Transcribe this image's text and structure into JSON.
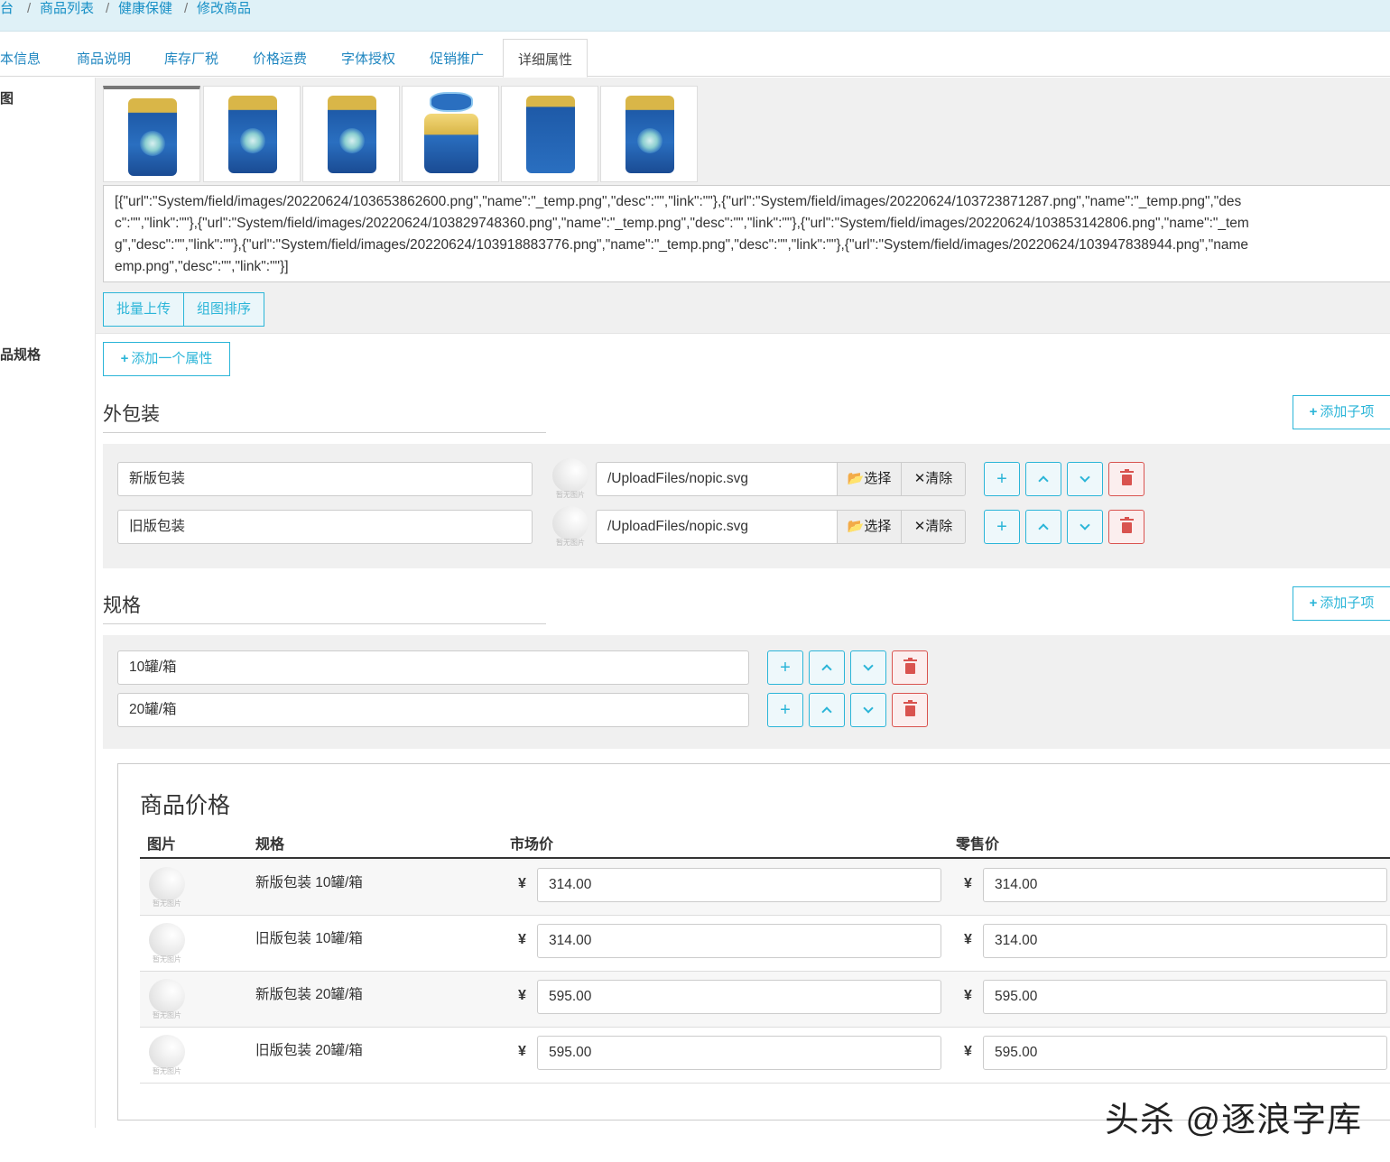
{
  "breadcrumb": [
    "台",
    "商品列表",
    "健康保健",
    "修改商品"
  ],
  "breadcrumb_sep": "/",
  "tabs": [
    "本信息",
    "商品说明",
    "库存厂税",
    "价格运费",
    "字体授权",
    "促销推广",
    "详细属性"
  ],
  "active_tab": "详细属性",
  "labels": {
    "images": "图",
    "specs": "品规格"
  },
  "gallery_json": [
    "[{\"url\":\"System/field/images/20220624/103653862600.png\",\"name\":\"_temp.png\",\"desc\":\"\",\"link\":\"\"},{\"url\":\"System/field/images/20220624/103723871287.png\",\"name\":\"_temp.png\",\"des",
    "c\":\"\",\"link\":\"\"},{\"url\":\"System/field/images/20220624/103829748360.png\",\"name\":\"_temp.png\",\"desc\":\"\",\"link\":\"\"},{\"url\":\"System/field/images/20220624/103853142806.png\",\"name\":\"_tem",
    "g\",\"desc\":\"\",\"link\":\"\"},{\"url\":\"System/field/images/20220624/103918883776.png\",\"name\":\"_temp.png\",\"desc\":\"\",\"link\":\"\"},{\"url\":\"System/field/images/20220624/103947838944.png\",\"name",
    "emp.png\",\"desc\":\"\",\"link\":\"\"}]"
  ],
  "buttons": {
    "batch_upload": "批量上传",
    "sort_images": "组图排序",
    "add_attribute": "添加一个属性",
    "add_child": "添加子项",
    "select": "选择",
    "clear": "清除"
  },
  "groups": {
    "packaging": {
      "title": "外包装",
      "items": [
        {
          "value": "新版包装",
          "image_path": "/UploadFiles/nopic.svg"
        },
        {
          "value": "旧版包装",
          "image_path": "/UploadFiles/nopic.svg"
        }
      ]
    },
    "spec": {
      "title": "规格",
      "items": [
        {
          "value": "10罐/箱"
        },
        {
          "value": "20罐/箱"
        }
      ]
    }
  },
  "nopic_caption": "暂无图片",
  "price": {
    "title": "商品价格",
    "headers": {
      "image": "图片",
      "spec": "规格",
      "market": "市场价",
      "retail": "零售价"
    },
    "currency": "¥",
    "rows": [
      {
        "spec": "新版包装 10罐/箱",
        "market": "314.00",
        "retail": "314.00"
      },
      {
        "spec": "旧版包装 10罐/箱",
        "market": "314.00",
        "retail": "314.00"
      },
      {
        "spec": "新版包装 20罐/箱",
        "market": "595.00",
        "retail": "595.00"
      },
      {
        "spec": "旧版包装 20罐/箱",
        "market": "595.00",
        "retail": "595.00"
      }
    ]
  },
  "watermark": "头杀 @逐浪字库",
  "colors": {
    "accent": "#2bb5d8",
    "link": "#1890c6",
    "danger": "#d9534f",
    "panel": "#f0f0f0"
  },
  "icons": [
    "plus-icon",
    "chevron-up-icon",
    "chevron-down-icon",
    "trash-icon",
    "folder-open-icon",
    "close-icon"
  ]
}
